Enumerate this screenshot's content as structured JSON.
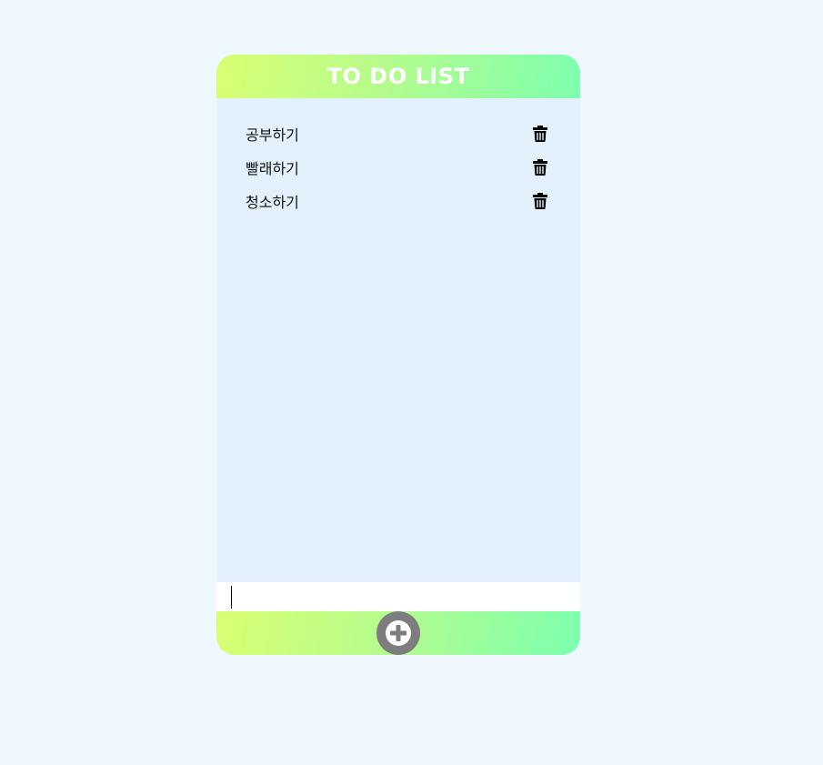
{
  "header": {
    "title": "TO DO LIST"
  },
  "todos": [
    {
      "text": "공부하기",
      "delete_icon": "trash-icon"
    },
    {
      "text": "빨래하기",
      "delete_icon": "trash-icon"
    },
    {
      "text": "청소하기",
      "delete_icon": "trash-icon"
    }
  ],
  "input": {
    "value": "",
    "placeholder": ""
  },
  "add_button": {
    "icon": "plus-circle-icon"
  },
  "colors": {
    "page_background": "#eff7ff",
    "list_background": "#e3f1fc",
    "gradient_start": "#d9ff72",
    "gradient_end": "#7dffaf",
    "add_button": "#7d7d7d"
  }
}
